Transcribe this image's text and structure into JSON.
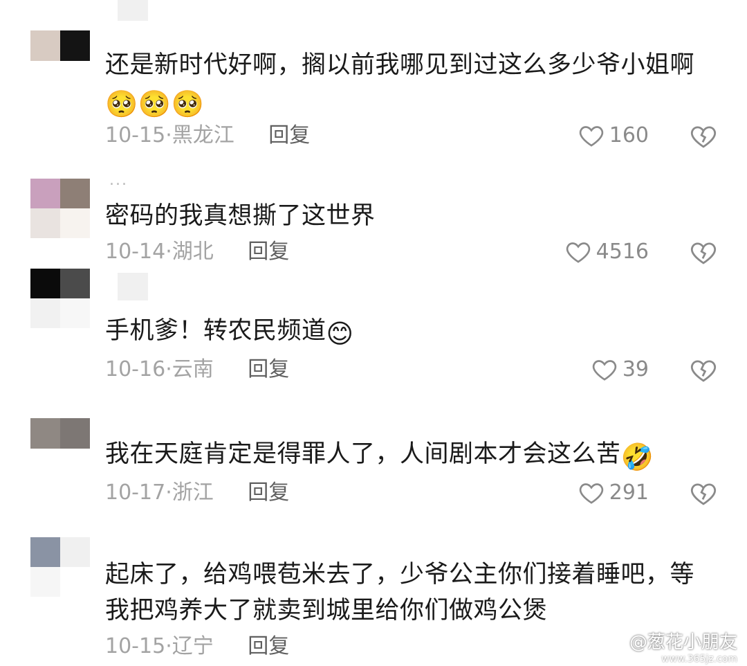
{
  "comments": [
    {
      "text": "还是新时代好啊，搁以前我哪见到过这么多少爷小姐啊",
      "emoji": "🥺🥺🥺",
      "date": "10-15",
      "region": "黑龙江",
      "reply_label": "回复",
      "likes": "160",
      "avatar_colors": [
        "#d8cbc2",
        "#141414",
        "#efe9e5",
        "#ffffff"
      ]
    },
    {
      "text": "密码的我真想撕了这世界",
      "emoji": "",
      "date": "10-14",
      "region": "湖北",
      "reply_label": "回复",
      "likes": "4516",
      "avatar_colors": [
        "#c9a0bd",
        "#8e7f76",
        "#e9e3e0",
        "#f7f3ef"
      ]
    },
    {
      "text": "手机爹！转农民频道",
      "emoji": "😊",
      "date": "10-16",
      "region": "云南",
      "reply_label": "回复",
      "likes": "39",
      "avatar_colors": [
        "#0b0b0b",
        "#4b4b4b",
        "#f1f1f1",
        "#f7f7f7"
      ]
    },
    {
      "text": "我在天庭肯定是得罪人了，人间剧本才会这么苦",
      "emoji": "🤣",
      "date": "10-17",
      "region": "浙江",
      "reply_label": "回复",
      "likes": "291",
      "avatar_colors": [
        "#8f8883",
        "#7d7774",
        "#ffffff",
        "#ffffff"
      ]
    },
    {
      "text": "起床了，给鸡喂苞米去了，少爷公主你们接着睡吧，等我把鸡养大了就卖到城里给你们做鸡公煲",
      "emoji": "",
      "date": "10-15",
      "region": "辽宁",
      "reply_label": "回复",
      "likes": "",
      "avatar_colors": [
        "#8a93a4",
        "#f0f0f0",
        "#f6f6f6",
        "#ffffff"
      ]
    }
  ],
  "ellipsis": "...",
  "watermark": {
    "text": "@葱花小朋友",
    "site": "www.365jz.com"
  },
  "colors": {
    "text": "#1a1a1a",
    "meta": "#a3a3a3",
    "reply": "#606060",
    "icon": "#8a8a8a"
  },
  "icons": {
    "like": "heart-outline-icon",
    "dislike": "broken-heart-icon"
  }
}
